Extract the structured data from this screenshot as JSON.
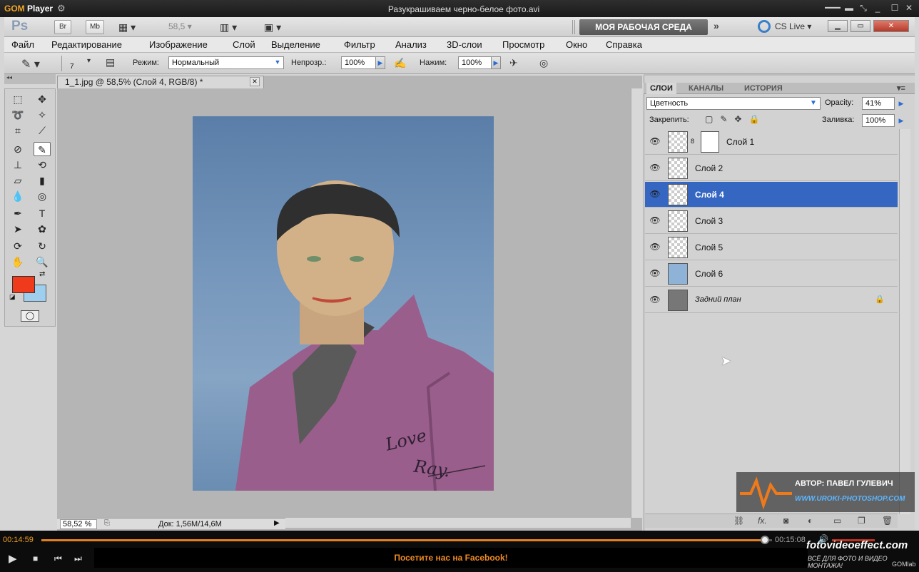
{
  "gom_player": {
    "logo_brand": "GOM",
    "logo_text": "Player",
    "title": "Разукрашиваем черно-белое фото.avi",
    "time_current": "00:14:59",
    "time_total": "00:15:08",
    "ad_text": "Посетите нас на Facebook!",
    "site_logo": "fotovideoeffect.com",
    "site_tagline": "ВСЁ ДЛЯ ФОТО И ВИДЕО МОНТАЖА!",
    "gomlab": "GOMlab",
    "progress": 0.99
  },
  "photoshop": {
    "logo": "Ps",
    "bridge_label": "Br",
    "minibridge_label": "Mb",
    "zoom_value": "58,5",
    "workspace_button": "МОЯ РАБОЧАЯ СРЕДА",
    "cs_live": "CS Live",
    "menu": [
      "Файл",
      "Редактирование",
      "Изображение",
      "Слой",
      "Выделение",
      "Фильтр",
      "Анализ",
      "3D-слои",
      "Просмотр",
      "Окно",
      "Справка"
    ],
    "options": {
      "brush_size": "7",
      "mode_label": "Режим:",
      "mode_value": "Нормальный",
      "opacity_label": "Непрозр.:",
      "opacity_value": "100%",
      "flow_label": "Нажим:",
      "flow_value": "100%"
    },
    "document": {
      "tab_title": "1_1.jpg @ 58,5% (Слой 4, RGB/8) *",
      "zoom_status": "58,52 %",
      "doc_info": "Док: 1,56M/14,6M",
      "signature_line1": "Love",
      "signature_line2": "Ray."
    },
    "colors": {
      "foreground": "#f03a1c",
      "background": "#9fcfef",
      "selection": "#3466c2"
    },
    "panels": {
      "tabs": [
        "СЛОИ",
        "КАНАЛЫ",
        "ИСТОРИЯ"
      ],
      "blend_mode": "Цветность",
      "opacity_label": "Opacity:",
      "opacity_value": "41%",
      "lock_label": "Закрепить:",
      "fill_label": "Заливка:",
      "fill_value": "100%",
      "layers": [
        {
          "name": "Слой 1",
          "selected": false
        },
        {
          "name": "Слой 2",
          "selected": false
        },
        {
          "name": "Слой 4",
          "selected": true
        },
        {
          "name": "Слой 3",
          "selected": false
        },
        {
          "name": "Слой 5",
          "selected": false
        },
        {
          "name": "Слой 6",
          "selected": false
        },
        {
          "name": "Задний план",
          "selected": false
        }
      ]
    },
    "watermark": {
      "author": "АВТОР: ПАВЕЛ ГУЛЕВИЧ",
      "url": "WWW.UROKI-PHOTOSHOP.COM"
    }
  }
}
